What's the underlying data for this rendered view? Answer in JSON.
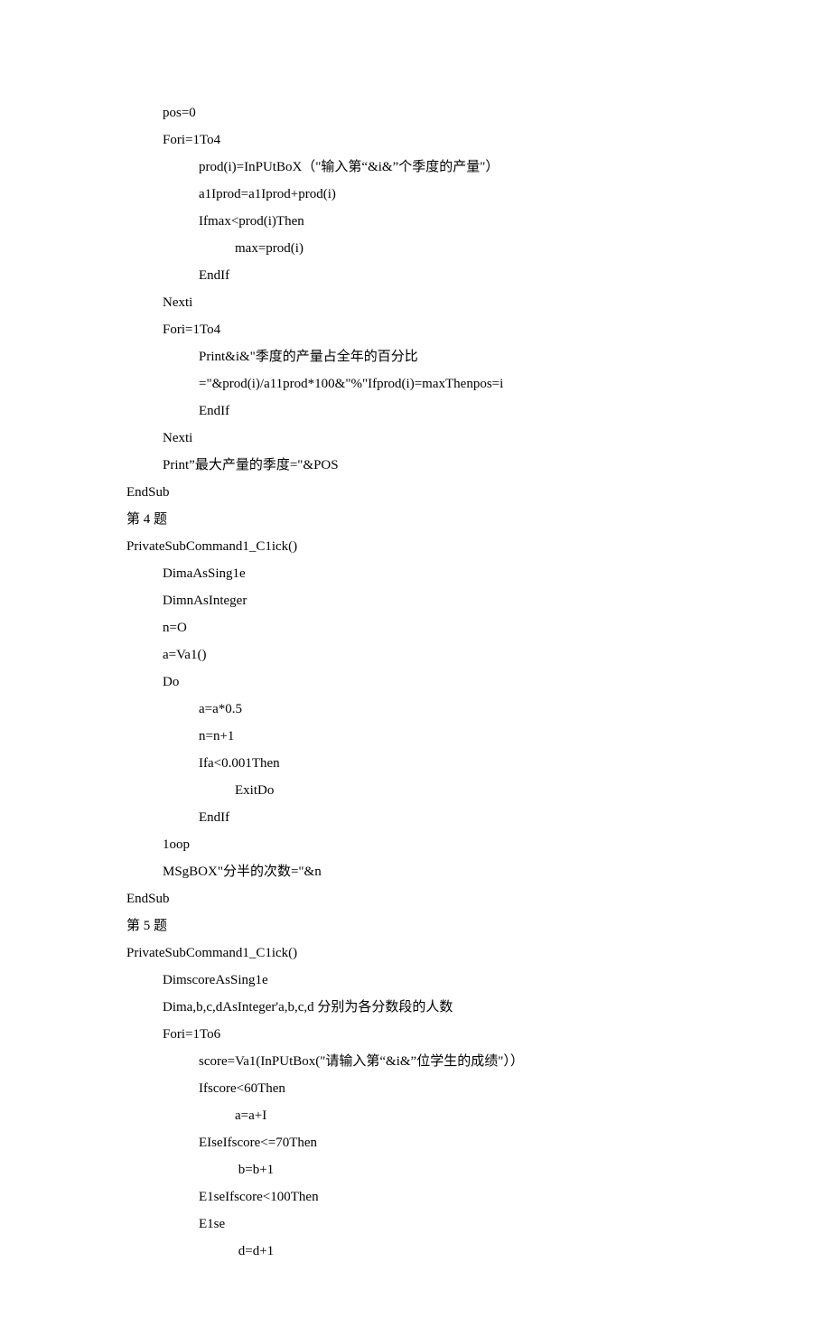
{
  "lines": [
    {
      "cls": "i1",
      "text": "pos=0"
    },
    {
      "cls": "i1",
      "text": "Fori=1To4"
    },
    {
      "cls": "i2",
      "text": "prod(i)=InPUtBoX（\"输入第“&i&”个季度的产量\"）"
    },
    {
      "cls": "i2",
      "text": "a1Iprod=a1Iprod+prod(i)"
    },
    {
      "cls": "i2",
      "text": "Ifmax<prod(i)Then"
    },
    {
      "cls": "i3",
      "text": "max=prod(i)"
    },
    {
      "cls": "i2",
      "text": "EndIf"
    },
    {
      "cls": "i1",
      "text": "Nexti"
    },
    {
      "cls": "i1",
      "text": "Fori=1To4"
    },
    {
      "cls": "i2",
      "text": "Print&i&\"季度的产量占全年的百分比"
    },
    {
      "cls": "i2",
      "text": "=\"&prod(i)/a11prod*100&\"%\"Ifprod(i)=maxThenpos=i"
    },
    {
      "cls": "i2",
      "text": "EndIf"
    },
    {
      "cls": "i1",
      "text": "Nexti"
    },
    {
      "cls": "i1",
      "text": "Print”最大产量的季度=\"&POS"
    },
    {
      "cls": "",
      "text": "EndSub"
    },
    {
      "cls": "",
      "text": "第 4 题"
    },
    {
      "cls": "",
      "text": "PrivateSubCommand1_C1ick()"
    },
    {
      "cls": "i1",
      "text": "DimaAsSing1e"
    },
    {
      "cls": "i1",
      "text": "DimnAsInteger"
    },
    {
      "cls": "i1",
      "text": "n=O"
    },
    {
      "cls": "i1",
      "text": "a=Va1()"
    },
    {
      "cls": "i1",
      "text": "Do"
    },
    {
      "cls": "i2",
      "text": "a=a*0.5"
    },
    {
      "cls": "i2",
      "text": "n=n+1"
    },
    {
      "cls": "i2",
      "text": "Ifa<0.001Then"
    },
    {
      "cls": "i3",
      "text": "ExitDo"
    },
    {
      "cls": "i2",
      "text": "EndIf"
    },
    {
      "cls": "i1",
      "text": "1oop"
    },
    {
      "cls": "i1",
      "text": "MSgBOX\"分半的次数=\"&n"
    },
    {
      "cls": "",
      "text": "EndSub"
    },
    {
      "cls": "",
      "text": "第 5 题"
    },
    {
      "cls": "",
      "text": "PrivateSubCommand1_C1ick()"
    },
    {
      "cls": "i1",
      "text": "DimscoreAsSing1e"
    },
    {
      "cls": "i1",
      "text": "Dima,b,c,dAsInteger'a,b,c,d 分别为各分数段的人数"
    },
    {
      "cls": "i1",
      "text": "Fori=1To6"
    },
    {
      "cls": "i2",
      "text": "score=Va1(InPUtBox(\"请输入第“&i&”位学生的成绩\"））"
    },
    {
      "cls": "i2",
      "text": "Ifscore<60Then"
    },
    {
      "cls": "i3",
      "text": "a=a+I"
    },
    {
      "cls": "i2",
      "text": "EIseIfscore<=70Then"
    },
    {
      "cls": "i3",
      "text": " b=b+1"
    },
    {
      "cls": "i2",
      "text": "E1seIfscore<100Then"
    },
    {
      "cls": "i2",
      "text": "E1se"
    },
    {
      "cls": "i3",
      "text": " d=d+1"
    }
  ]
}
